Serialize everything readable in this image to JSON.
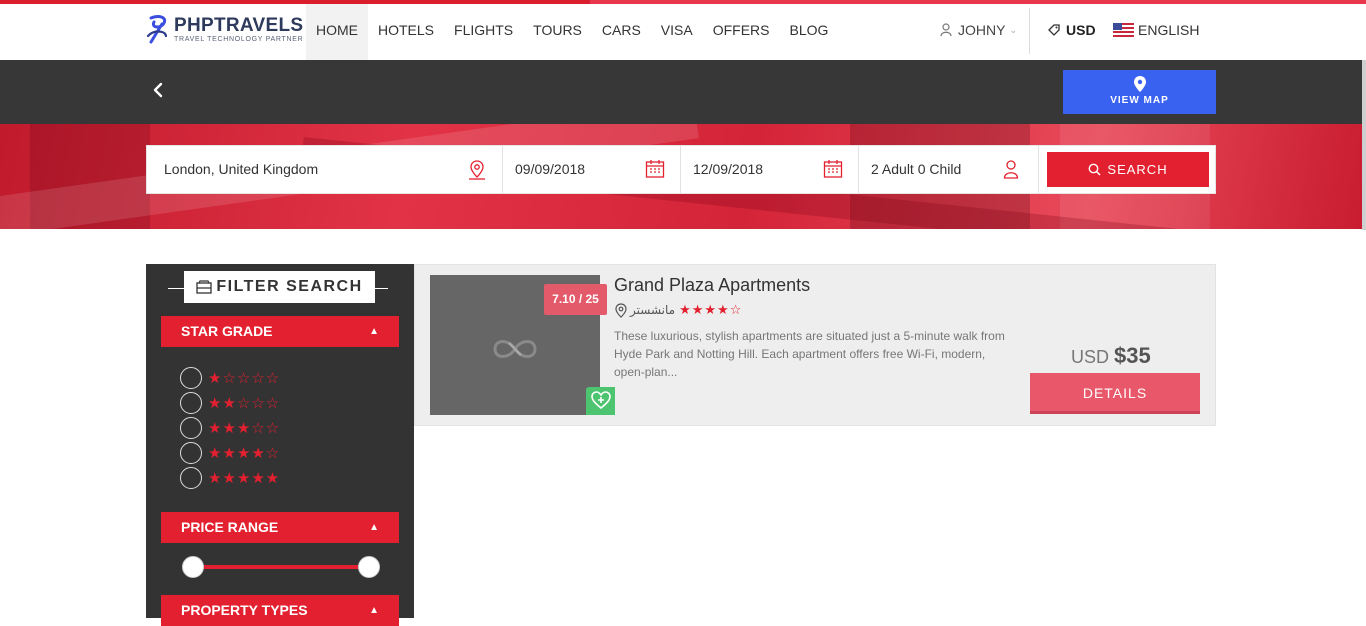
{
  "header": {
    "logo_title": "PHPTRAVELS",
    "logo_subtitle": "TRAVEL TECHNOLOGY PARTNER",
    "nav": [
      "HOME",
      "HOTELS",
      "FLIGHTS",
      "TOURS",
      "CARS",
      "VISA",
      "OFFERS",
      "BLOG"
    ],
    "active_nav": "HOTELS",
    "user": "JOHNY",
    "currency": "USD",
    "language": "ENGLISH"
  },
  "toolbar": {
    "view_map_label": "VIEW MAP"
  },
  "search": {
    "location": "London, United Kingdom",
    "checkin": "09/09/2018",
    "checkout": "12/09/2018",
    "guests": "2 Adult 0 Child",
    "button_label": "SEARCH"
  },
  "filters": {
    "title": "FILTER SEARCH",
    "star_grade_label": "STAR GRADE",
    "star_options": [
      "★☆☆☆☆",
      "★★☆☆☆",
      "★★★☆☆",
      "★★★★☆",
      "★★★★★"
    ],
    "price_range_label": "PRICE RANGE",
    "property_types_label": "PROPERTY TYPES"
  },
  "results": [
    {
      "name": "Grand Plaza Apartments",
      "rating_badge": "7.10 / 25",
      "location": "مانشستر",
      "stars": "★★★★☆",
      "description": "These luxurious, stylish apartments are situated just a 5-minute walk from Hyde Park and Notting Hill. Each apartment offers free Wi-Fi, modern, open-plan...",
      "currency": "USD",
      "price": "$35",
      "details_label": "DETAILS"
    }
  ],
  "colors": {
    "accent": "#e3202f",
    "map_button": "#3a62f0",
    "dark": "#333333",
    "wishlist": "#4cc470"
  }
}
